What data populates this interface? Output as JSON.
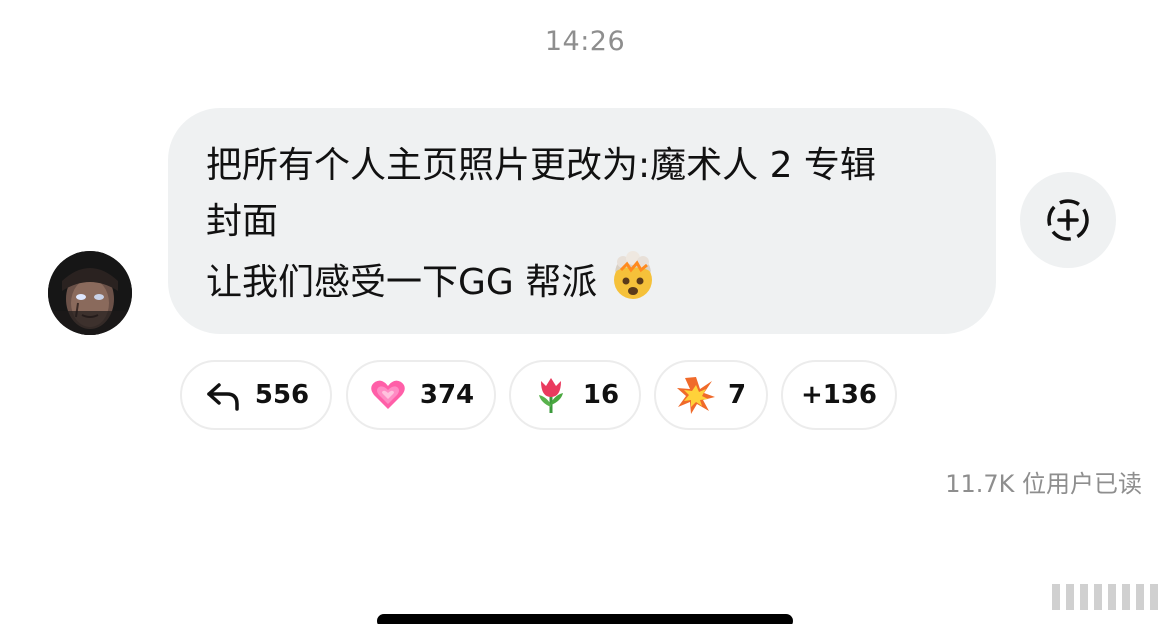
{
  "chat": {
    "timestamp": "14:26",
    "message": {
      "lines": [
        "把所有个人主页照片更改为:魔术人 2 专辑",
        "封面",
        "让我们感受一下GG 帮派"
      ],
      "emoji": "exploding-head-emoji"
    },
    "add_reaction_icon": "add-reaction-icon",
    "reactions": [
      {
        "icon": "reply-arrow-icon",
        "count": "556"
      },
      {
        "icon": "growing-heart-icon",
        "count": "374"
      },
      {
        "icon": "tulip-icon",
        "count": "16"
      },
      {
        "icon": "collision-icon",
        "count": "7"
      },
      {
        "icon": "",
        "count": "+136"
      }
    ],
    "read_receipt": "11.7K 位用户已读"
  },
  "colors": {
    "bubble": "#eff1f2",
    "muted_text": "#8e8e8e",
    "chip_border": "#ececec"
  }
}
